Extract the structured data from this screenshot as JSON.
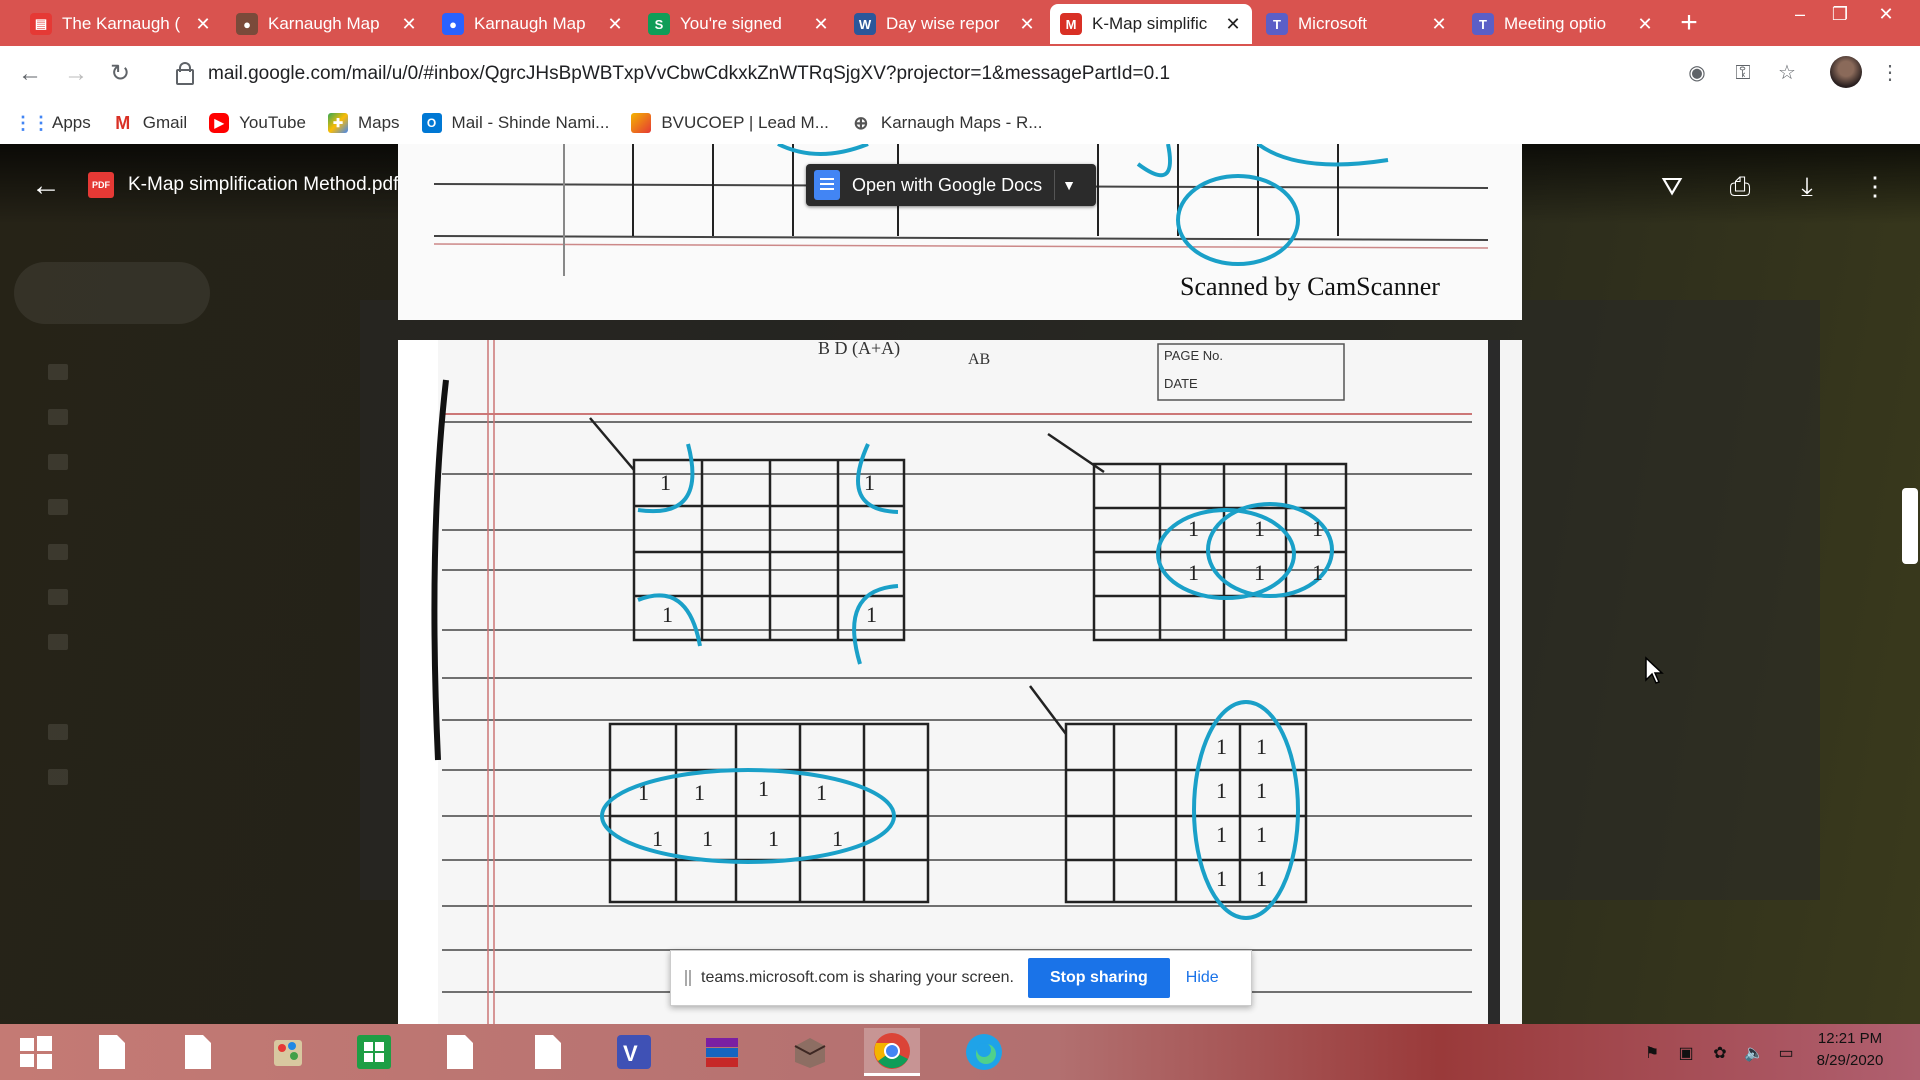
{
  "browser": {
    "tabs": [
      {
        "label": "The Karnaugh (",
        "icon_color": "#e53935",
        "icon": "pdf-icon"
      },
      {
        "label": "Karnaugh Map",
        "icon_color": "#7a4a3a",
        "icon": "site-icon"
      },
      {
        "label": "Karnaugh Map",
        "icon_color": "#2962ff",
        "icon": "site-icon"
      },
      {
        "label": "You're signed",
        "icon_color": "#0f9d58",
        "icon": "sharepoint-icon"
      },
      {
        "label": "Day wise repor",
        "icon_color": "#2b579a",
        "icon": "word-icon"
      },
      {
        "label": "K-Map simplific",
        "icon_color": "#d93025",
        "icon": "gmail-icon"
      },
      {
        "label": "Microsoft",
        "icon_color": "#5b5fc7",
        "icon": "teams-icon"
      },
      {
        "label": "Meeting optio",
        "icon_color": "#5b5fc7",
        "icon": "teams-icon"
      }
    ],
    "active_tab_index": 5,
    "url": "mail.google.com/mail/u/0/#inbox/QgrcJHsBpWBTxpVvCbwCdkxkZnWTRqSjgXV?projector=1&messagePartId=0.1",
    "bookmarks": [
      {
        "label": "Apps",
        "icon": "apps-grid-icon"
      },
      {
        "label": "Gmail",
        "icon": "gmail-icon"
      },
      {
        "label": "YouTube",
        "icon": "youtube-icon"
      },
      {
        "label": "Maps",
        "icon": "maps-icon"
      },
      {
        "label": "Mail - Shinde Nami...",
        "icon": "outlook-icon"
      },
      {
        "label": "BVUCOEP | Lead M...",
        "icon": "bookmark-icon"
      },
      {
        "label": "Karnaugh Maps - R...",
        "icon": "globe-icon"
      }
    ]
  },
  "viewer": {
    "filename": "K-Map simplification Method.pdf",
    "open_with": "Open with Google Docs",
    "page1_footer": "Scanned by CamScanner",
    "page2_header": {
      "page_no": "PAGE No.",
      "date": "DATE"
    }
  },
  "share_banner": {
    "message": "teams.microsoft.com is sharing your screen.",
    "stop_label": "Stop sharing",
    "hide_label": "Hide"
  },
  "taskbar": {
    "time": "12:21 PM",
    "date": "8/29/2020"
  }
}
